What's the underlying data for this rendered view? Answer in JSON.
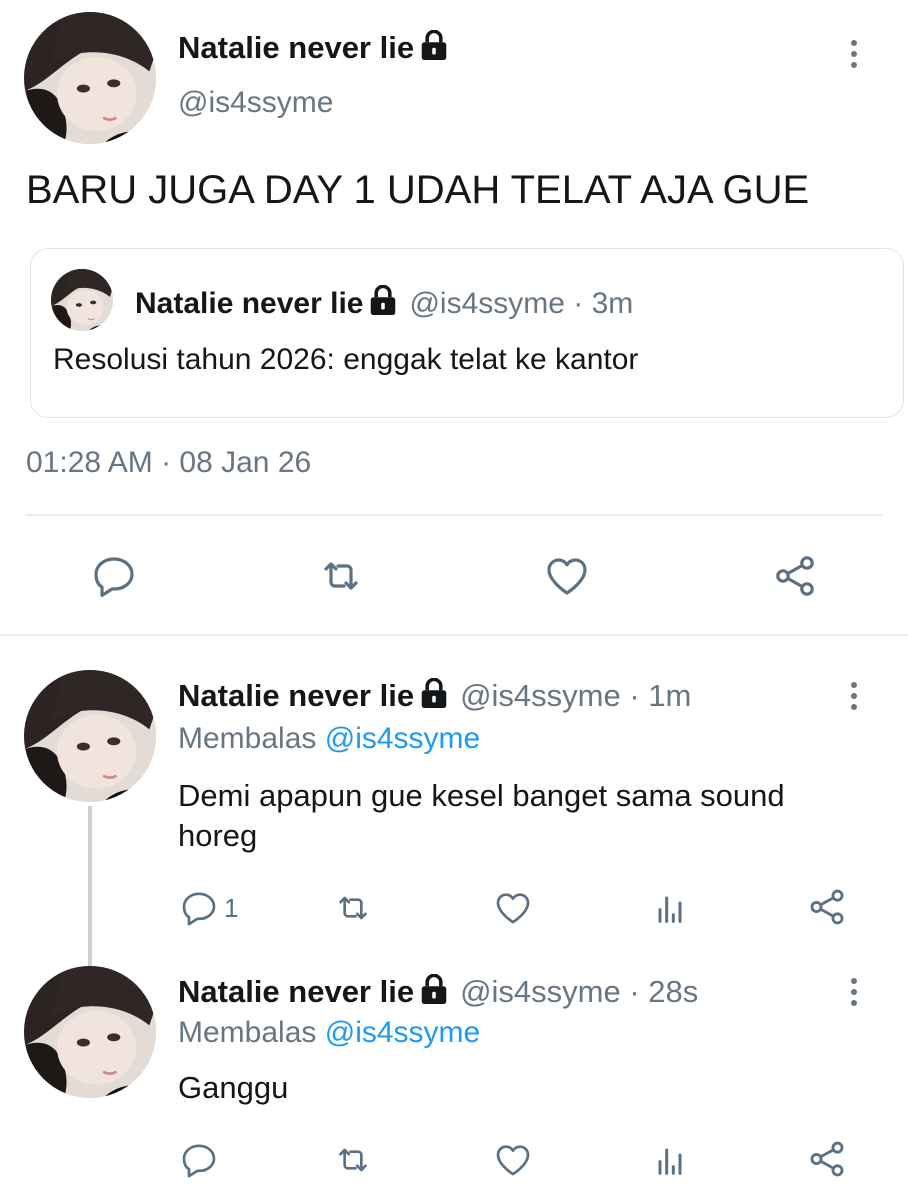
{
  "main_tweet": {
    "author_name": "Natalie never lie",
    "handle": "@is4ssyme",
    "text": "BARU JUGA DAY 1 UDAH TELAT AJA GUE",
    "quote": {
      "author_name": "Natalie never lie",
      "handle_time": "@is4ssyme · 3m",
      "text": "Resolusi tahun 2026: enggak telat ke kantor"
    },
    "timestamp": "01:28 AM · 08 Jan 26",
    "actions": [
      "reply-icon",
      "retweet-icon",
      "like-icon",
      "share-icon"
    ]
  },
  "replies": [
    {
      "author_name": "Natalie never lie",
      "handle_time": "@is4ssyme · 1m",
      "replying_prefix": "Membalas",
      "replying_to": "@is4ssyme",
      "text_line1": "Demi apapun gue kesel banget sama sound",
      "text_line2": "horeg",
      "reply_count": "1"
    },
    {
      "author_name": "Natalie never lie",
      "handle_time": "@is4ssyme · 28s",
      "replying_prefix": "Membalas",
      "replying_to": "@is4ssyme",
      "text_line1": "Ganggu",
      "text_line2": "",
      "reply_count": ""
    }
  ],
  "colors": {
    "text": "#14171a",
    "secondary": "#687684",
    "link": "#1d9bf0",
    "divider": "#e6ecf0"
  }
}
